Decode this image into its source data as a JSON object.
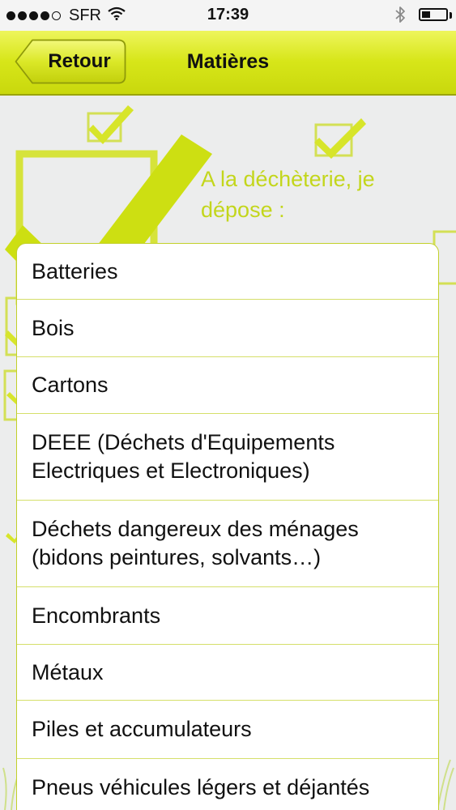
{
  "status_bar": {
    "carrier": "SFR",
    "time": "17:39",
    "signal_bars_filled": 4,
    "signal_bars_total": 5,
    "battery_level": 0.35
  },
  "nav": {
    "back_label": "Retour",
    "title": "Matières"
  },
  "header_text": "A la déchèterie, je dépose :",
  "items": [
    "Batteries",
    "Bois",
    "Cartons",
    "DEEE (Déchets d'Equipements Electriques et Electroniques)",
    "Déchets dangereux des ménages (bidons peintures, solvants…)",
    "Encombrants",
    "Métaux",
    "Piles et accumulateurs",
    "Pneus véhicules légers et déjantés"
  ],
  "colors": {
    "accent": "#d7e619",
    "accent_text": "#c3d61c",
    "list_border": "#c2d02a"
  },
  "icons": [
    "wifi-icon",
    "bluetooth-icon",
    "battery-icon",
    "back-arrow-icon",
    "checkbox-icon"
  ]
}
